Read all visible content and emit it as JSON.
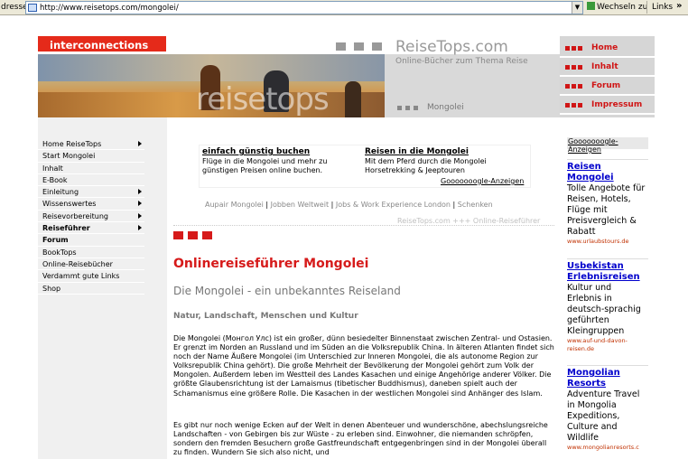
{
  "browser": {
    "address_label": "dresse",
    "url": "http://www.reisetops.com/mongolei/",
    "go_label": "Wechseln zu",
    "links_label": "Links",
    "links_more": "»"
  },
  "header": {
    "logo": "interconnections",
    "banner_text": "reisetops",
    "site_name": "ReiseTops.com",
    "tagline": "Online-Bücher zum Thema Reise",
    "breadcrumb": "Mongolei"
  },
  "right_nav": [
    {
      "label": "Home"
    },
    {
      "label": "Inhalt"
    },
    {
      "label": "Forum"
    },
    {
      "label": "Impressum"
    }
  ],
  "left_nav": [
    {
      "label": "Home ReiseTops",
      "arrow": true,
      "bold": false
    },
    {
      "label": "Start Mongolei",
      "arrow": false,
      "bold": false
    },
    {
      "label": "Inhalt",
      "arrow": false,
      "bold": false
    },
    {
      "label": "E-Book",
      "arrow": false,
      "bold": false
    },
    {
      "label": "Einleitung",
      "arrow": true,
      "bold": false
    },
    {
      "label": "Wissenswertes",
      "arrow": true,
      "bold": false
    },
    {
      "label": "Reisevorbereitung",
      "arrow": true,
      "bold": false
    },
    {
      "label": "Reiseführer",
      "arrow": true,
      "bold": true
    },
    {
      "label": "Forum",
      "arrow": false,
      "bold": true
    },
    {
      "label": "BookTops",
      "arrow": false,
      "bold": false
    },
    {
      "label": "Online-Reisebücher",
      "arrow": false,
      "bold": false
    },
    {
      "label": "Verdammt gute Links",
      "arrow": false,
      "bold": false
    },
    {
      "label": "Shop",
      "arrow": false,
      "bold": false
    }
  ],
  "top_ads": {
    "ad1_title": "einfach günstig buchen",
    "ad1_line1": "Flüge in die Mongolei und mehr zu",
    "ad1_line2": "günstigen Preisen online buchen.",
    "ad2_title": "Reisen in die Mongolei",
    "ad2_line1": "Mit dem Pferd durch die Mongolei",
    "ad2_line2": "Horsetrekking & Jeeptouren",
    "google_label": "Gooooooogle-Anzeigen"
  },
  "links_row": {
    "l1": "Aupair Mongolei",
    "l2": "Jobben Weltweit",
    "l3": "Jobs & Work Experience London",
    "l4": "Schenken",
    "sep": "|",
    "sub": "ReiseTops.com +++ Online-Reiseführer"
  },
  "main": {
    "title": "Onlinereiseführer Mongolei",
    "subtitle": "Die Mongolei - ein unbekanntes Reiseland",
    "subsub": "Natur, Landschaft, Menschen und Kultur",
    "p1": "Die Mongolei (Монгол Улс) ist ein großer, dünn besiedelter Binnenstaat zwischen Zentral- und Ostasien. Er grenzt im Norden an Russland und im Süden an die Volksrepublik China. In älteren Atlanten findet sich noch der Name Äußere Mongolei (im Unterschied zur Inneren Mongolei, die als autonome Region zur Volksrepublik China gehört). Die große Mehrheit der Bevölkerung der Mongolei gehört zum Volk der Mongolen. Außerdem leben im Westteil des Landes Kasachen und einige Angehörige anderer Völker. Die größte Glaubensrichtung ist der Lamaismus (tibetischer Buddhismus), daneben spielt auch der Schamanismus eine größere Rolle. Die Kasachen in der westlichen Mongolei sind Anhänger des Islam.",
    "p2": "Es gibt nur noch wenige Ecken auf der Welt in denen Abenteuer und wunderschöne, abechslungsreiche Landschaften - von Gebirgen bis zur Wüste - zu erleben sind. Einwohner, die niemanden schröpfen, sondern den fremden Besuchern große Gastfreundschaft entgegenbringen sind in der Mongolei überall zu finden. Wundern Sie sich also nicht, und"
  },
  "right_ads": {
    "header": "Gooooooogle-Anzeigen",
    "ads": [
      {
        "title": "Reisen Mongolei",
        "body": "Tolle Angebote für Reisen, Hotels, Flüge mit Preisvergleich & Rabatt",
        "url": "www.urlaubstours.de"
      },
      {
        "title": "Usbekistan Erlebnisreisen",
        "body": "Kultur und Erlebnis in deutsch-sprachig geführten Kleingruppen",
        "url": "www.auf-und-davon-reisen.de"
      },
      {
        "title": "Mongolian Resorts",
        "body": "Adventure Travel in Mongolia Expeditions, Culture and Wildlife",
        "url": "www.mongolianresorts.c"
      }
    ]
  },
  "colors": {
    "accent_red": "#d61a1a",
    "link_blue": "#0000cc",
    "nav_bg": "#f0f0f0"
  }
}
